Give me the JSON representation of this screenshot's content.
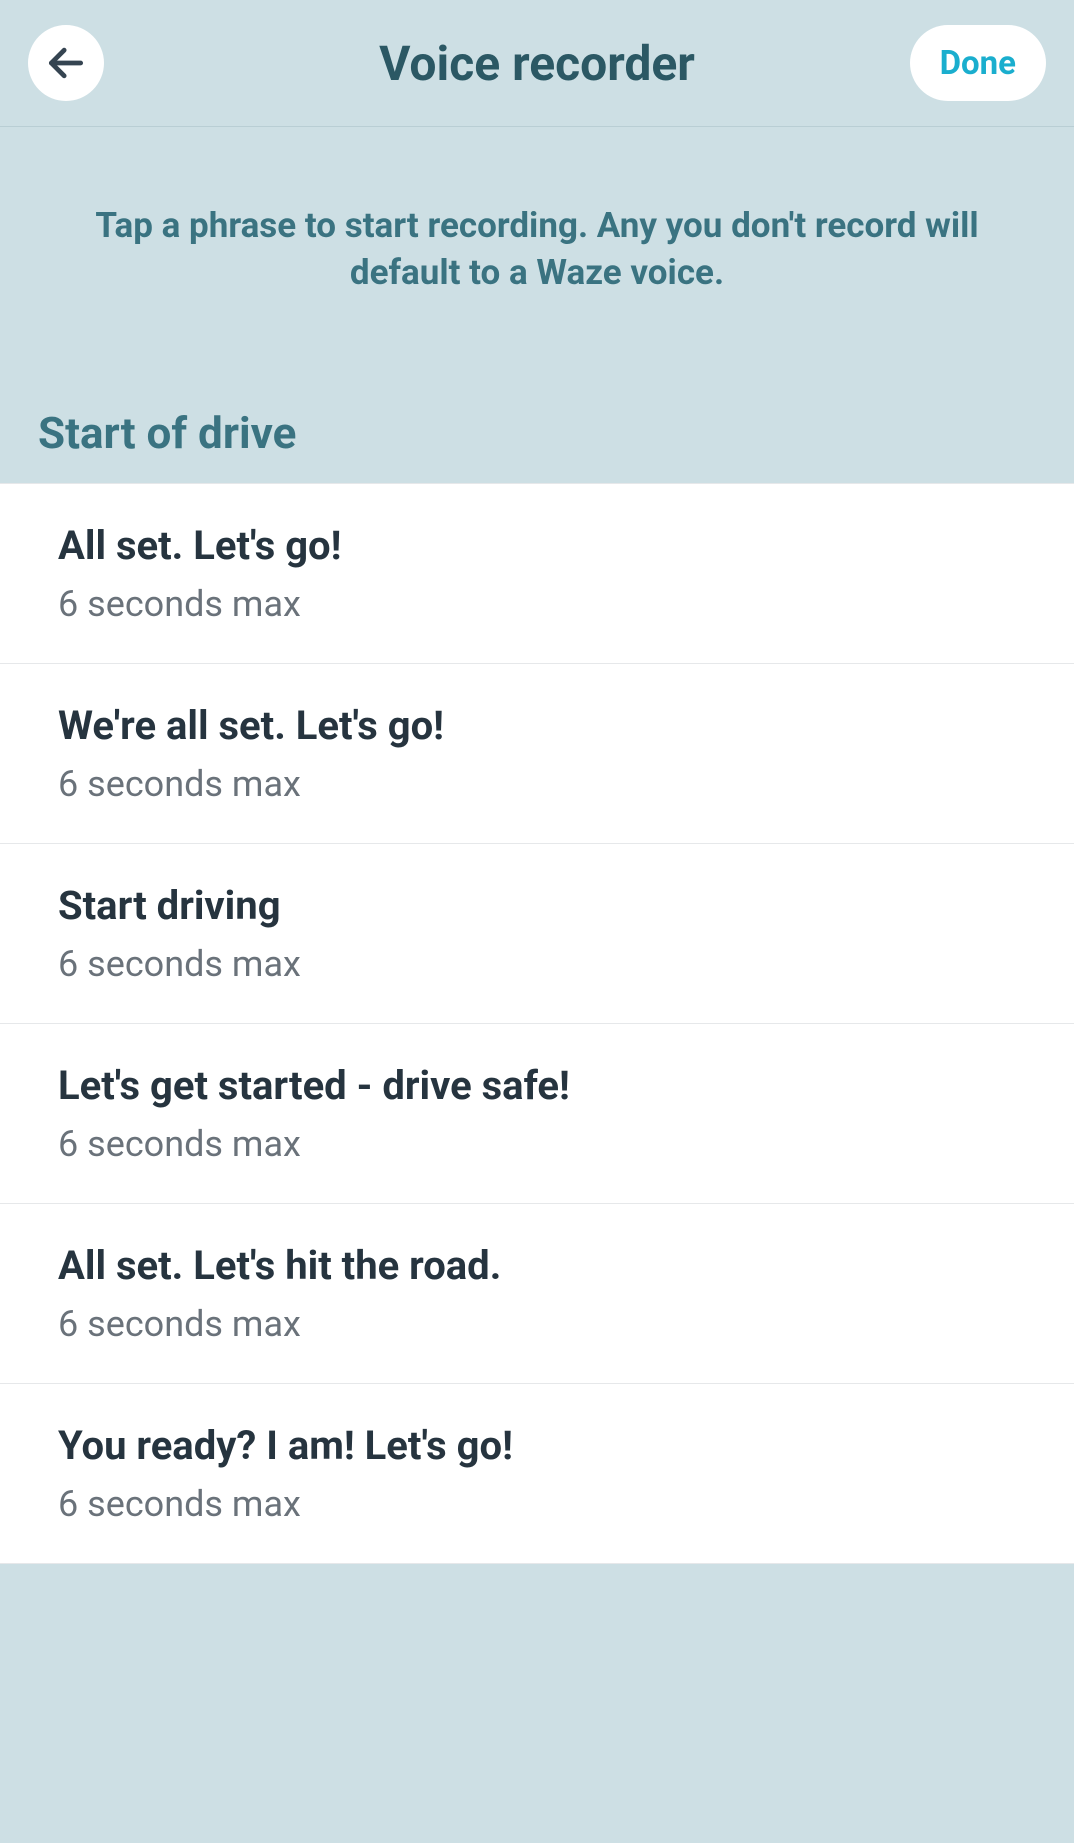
{
  "header": {
    "title": "Voice recorder",
    "done_label": "Done"
  },
  "instruction": "Tap a phrase to start recording. Any you don't record will default to a Waze voice.",
  "section": {
    "title": "Start of drive",
    "phrases": [
      {
        "label": "All set. Let's go!",
        "sub": "6 seconds max"
      },
      {
        "label": "We're all set. Let's go!",
        "sub": "6 seconds max"
      },
      {
        "label": "Start driving",
        "sub": "6 seconds max"
      },
      {
        "label": "Let's get started - drive safe!",
        "sub": "6 seconds max"
      },
      {
        "label": "All set. Let's hit the road.",
        "sub": "6 seconds max"
      },
      {
        "label": "You ready? I am! Let's go!",
        "sub": "6 seconds max"
      }
    ]
  }
}
